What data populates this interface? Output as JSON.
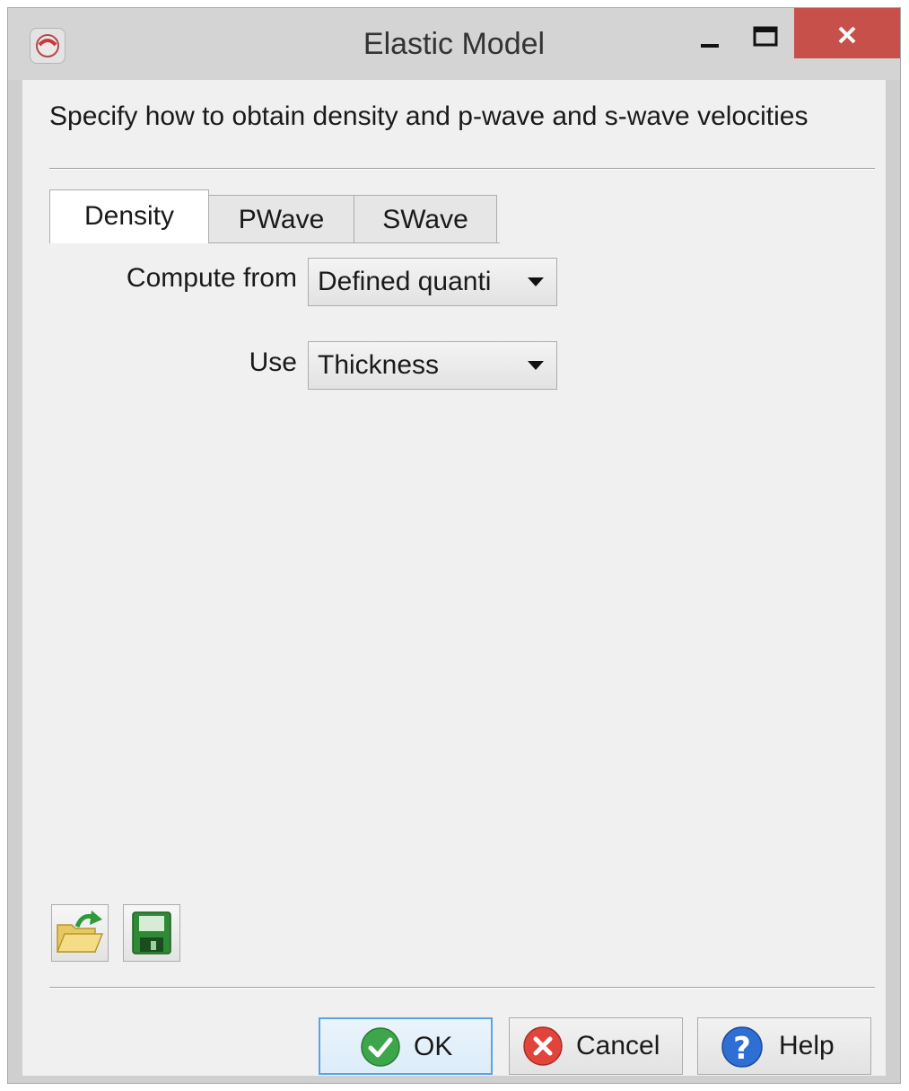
{
  "window": {
    "title": "Elastic Model",
    "icon": "app-logo-icon",
    "controls": {
      "minimize": "minimize-icon",
      "maximize": "maximize-icon",
      "close": "close-icon"
    }
  },
  "description": "Specify how to obtain density and p-wave and s-wave velocities",
  "tabs": [
    {
      "label": "Density",
      "active": true
    },
    {
      "label": "PWave",
      "active": false
    },
    {
      "label": "SWave",
      "active": false
    }
  ],
  "form": {
    "compute_from": {
      "label": "Compute from",
      "value": "Defined quanti"
    },
    "use": {
      "label": "Use",
      "value": "Thickness"
    }
  },
  "toolbar": {
    "open_icon": "open-folder-icon",
    "save_icon": "save-disk-icon"
  },
  "buttons": {
    "ok": {
      "label": "OK",
      "icon": "check-circle-icon"
    },
    "cancel": {
      "label": "Cancel",
      "icon": "cancel-circle-icon"
    },
    "help": {
      "label": "Help",
      "icon": "help-circle-icon"
    }
  },
  "colors": {
    "close_button": "#c7504b",
    "default_button_border": "#5aa4e3"
  }
}
